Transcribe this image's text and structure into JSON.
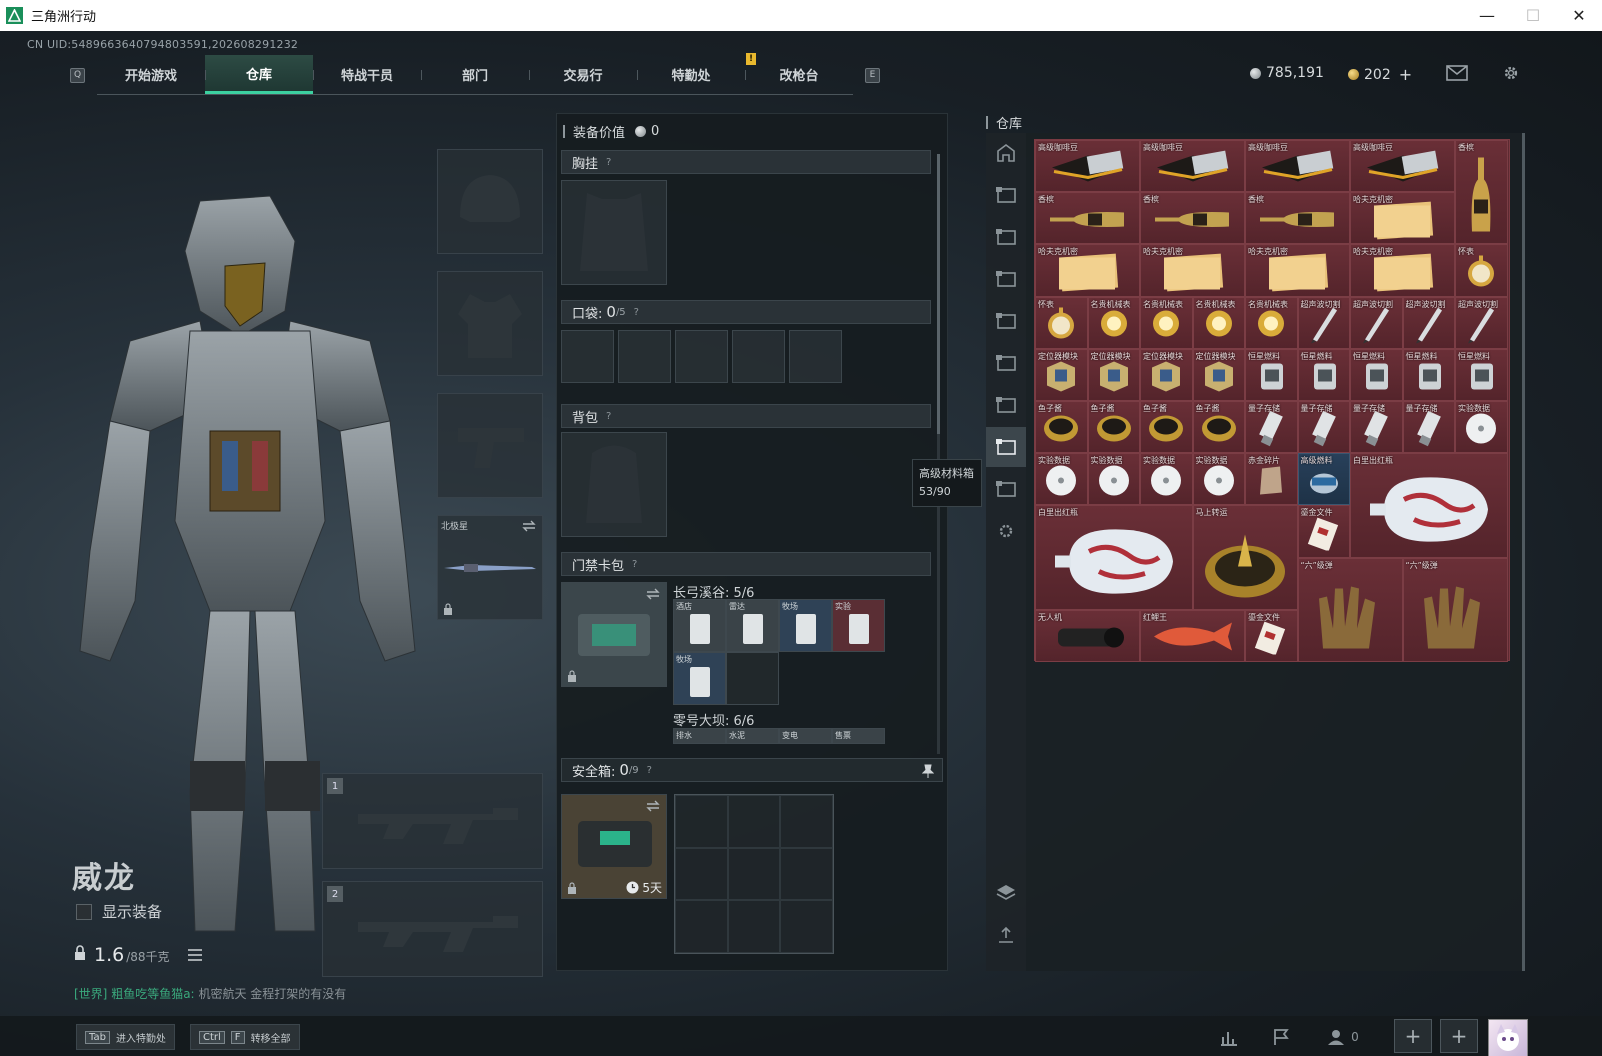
{
  "window": {
    "title": "三角洲行动",
    "minimize": "—",
    "maximize": "☐",
    "close": "✕"
  },
  "uid": "CN UID:5489663640794803591,202608291232",
  "nav": {
    "left_key": "Q",
    "right_key": "E",
    "notice": "!",
    "tabs": [
      "开始游戏",
      "仓库",
      "特战干员",
      "部门",
      "交易行",
      "特勤处",
      "改枪台"
    ],
    "active_tab": "仓库"
  },
  "currency": {
    "silver": "785,191",
    "gold": "202",
    "add": "+"
  },
  "character": {
    "name": "威龙",
    "show_equipment": "显示装备",
    "weight_current": "1.6",
    "weight_max": "/88千克",
    "world_chat_tag": "[世界]",
    "world_chat_user": "粗鱼吃等鱼猫a:",
    "world_chat_text": "机密航天 金程打架的有没有"
  },
  "gear": {
    "melee_label": "北极星",
    "weapon_slot_1": "1",
    "weapon_slot_2": "2"
  },
  "equipment": {
    "value_label": "装备价值",
    "value": "0",
    "chest_rig": "胸挂",
    "pocket_label": "口袋:",
    "pocket_count": "0",
    "pocket_max": "/5",
    "backpack": "背包",
    "keycard": "门禁卡包",
    "map1": "长弓溪谷: 5/6",
    "map2": "零号大坝: 6/6",
    "safe_label": "安全箱:",
    "safe_count": "0",
    "safe_max": "/9",
    "safe_days": "5天",
    "help": "?",
    "cards_map1": [
      "酒店",
      "雷达",
      "牧场",
      "实验",
      "牧场"
    ],
    "cards_map2": [
      "排水",
      "水泥",
      "变电",
      "售票"
    ]
  },
  "tooltip": {
    "title": "高级材料箱",
    "value": "53/90"
  },
  "warehouse": {
    "title": "仓库",
    "items": [
      {
        "label": "高级咖啡豆"
      },
      {
        "label": "高级咖啡豆"
      },
      {
        "label": "高级咖啡豆"
      },
      {
        "label": "高级咖啡豆"
      },
      {
        "label": "香槟"
      },
      {
        "label": "香槟"
      },
      {
        "label": "香槟"
      },
      {
        "label": "香槟"
      },
      {
        "label": "哈夫克机密"
      },
      {
        "label": "哈夫克机密"
      },
      {
        "label": "哈夫克机密"
      },
      {
        "label": "哈夫克机密"
      },
      {
        "label": "哈夫克机密"
      },
      {
        "label": "怀表"
      },
      {
        "label": "怀表"
      },
      {
        "label": "名贵机械表"
      },
      {
        "label": "名贵机械表"
      },
      {
        "label": "名贵机械表"
      },
      {
        "label": "名贵机械表"
      },
      {
        "label": "超声波切割"
      },
      {
        "label": "超声波切割"
      },
      {
        "label": "超声波切割"
      },
      {
        "label": "超声波切割"
      },
      {
        "label": "定位器模块"
      },
      {
        "label": "定位器模块"
      },
      {
        "label": "定位器模块"
      },
      {
        "label": "定位器模块"
      },
      {
        "label": "恒星燃料"
      },
      {
        "label": "恒星燃料"
      },
      {
        "label": "恒星燃料"
      },
      {
        "label": "恒星燃料"
      },
      {
        "label": "恒星燃料"
      },
      {
        "label": "鱼子酱"
      },
      {
        "label": "鱼子酱"
      },
      {
        "label": "鱼子酱"
      },
      {
        "label": "鱼子酱"
      },
      {
        "label": "量子存储"
      },
      {
        "label": "量子存储"
      },
      {
        "label": "量子存储"
      },
      {
        "label": "量子存储"
      },
      {
        "label": "实验数据"
      },
      {
        "label": "实验数据"
      },
      {
        "label": "实验数据"
      },
      {
        "label": "实验数据"
      },
      {
        "label": "实验数据"
      },
      {
        "label": "赤金碎片"
      },
      {
        "label": "高级燃料"
      },
      {
        "label": "白里出红瓶"
      },
      {
        "label": "白里出红瓶"
      },
      {
        "label": "马上转运"
      },
      {
        "label": "鎏金文件"
      },
      {
        "label": "“六”级弹"
      },
      {
        "label": "“六”级弹"
      },
      {
        "label": "无人机"
      },
      {
        "label": "红鲤王"
      },
      {
        "label": "鎏金文件"
      }
    ]
  },
  "bottom": {
    "tab_key": "Tab",
    "tab_label": "进入特勤处",
    "ctrl_key": "Ctrl",
    "f_key": "F",
    "transfer_label": "转移全部",
    "friends_count": "0"
  }
}
